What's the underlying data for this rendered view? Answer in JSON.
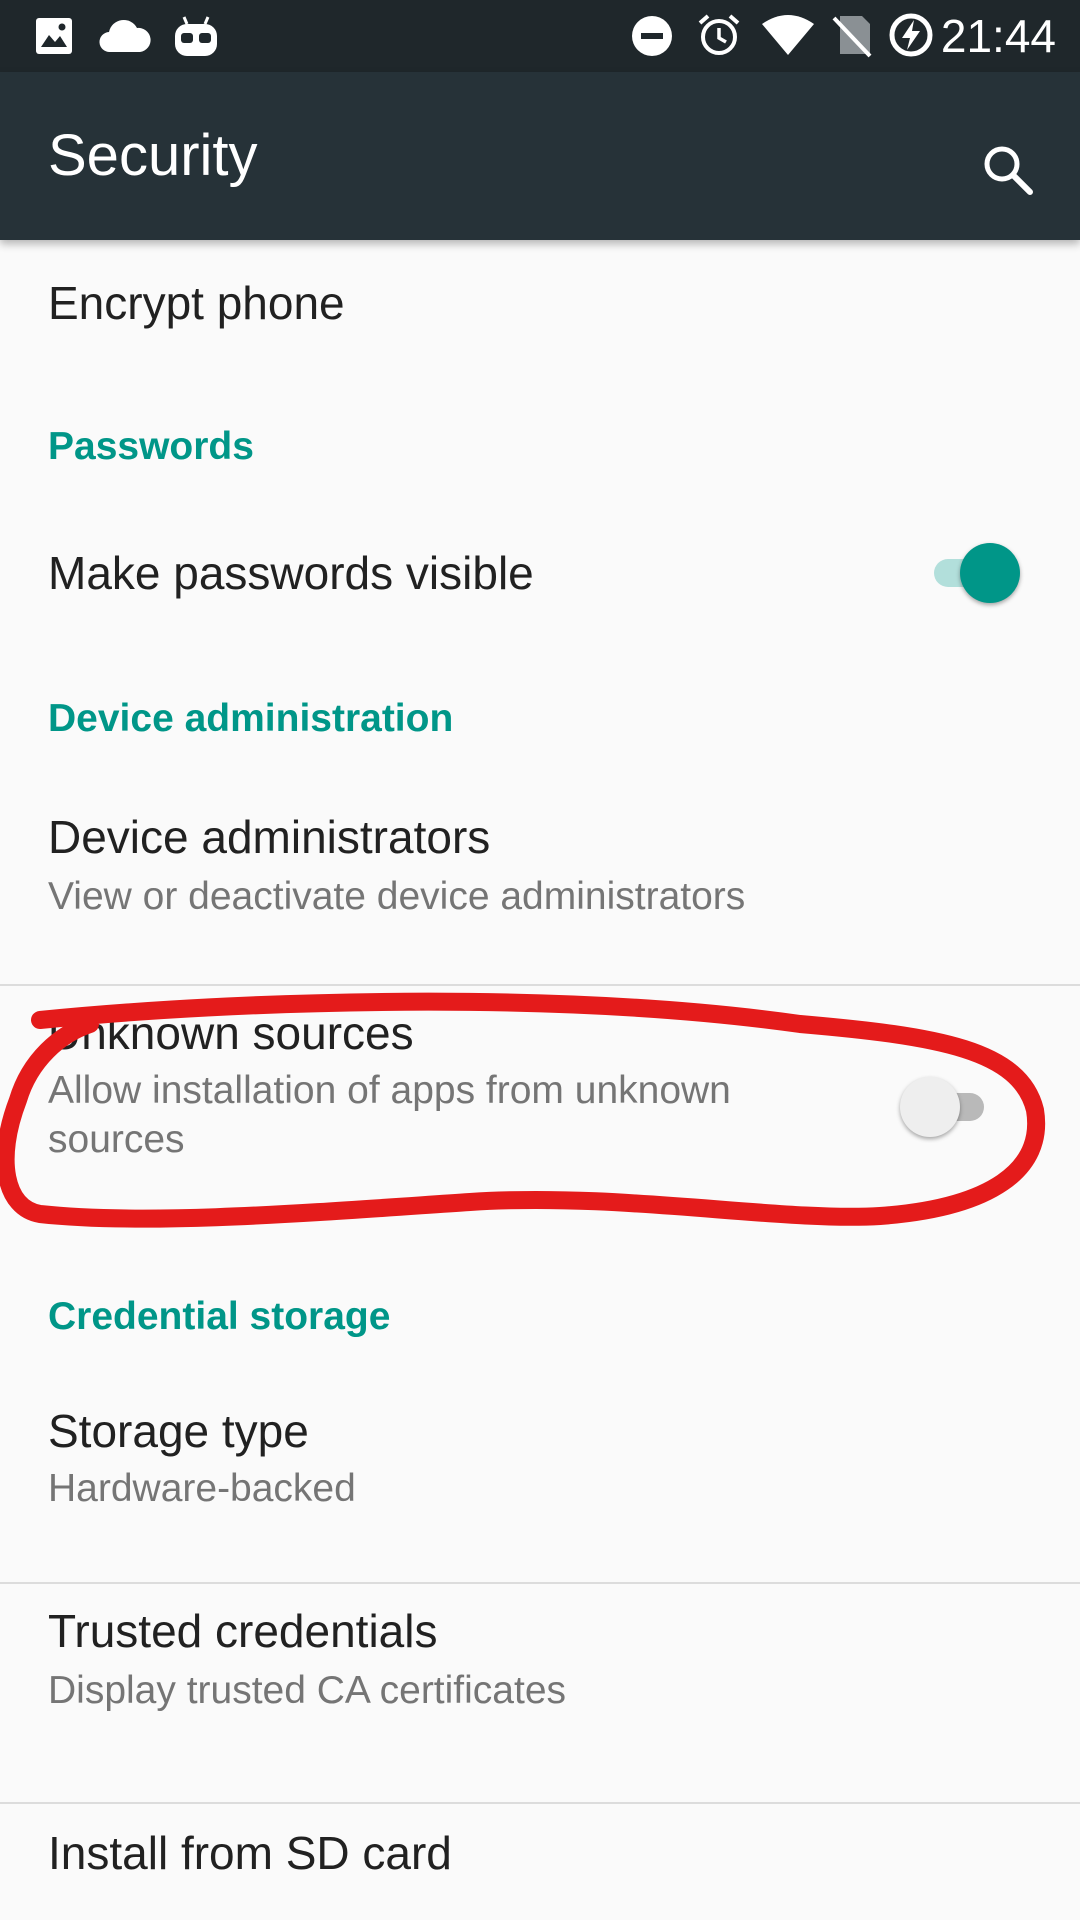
{
  "status_bar": {
    "time": "21:44",
    "icons": [
      "image-icon",
      "cloud-icon",
      "robot-icon",
      "do-not-disturb-icon",
      "alarm-icon",
      "wifi-icon",
      "no-sim-icon",
      "battery-charging-icon"
    ]
  },
  "app_bar": {
    "title": "Security",
    "search_icon": "search-icon"
  },
  "items": {
    "encrypt": {
      "title": "Encrypt phone"
    },
    "passwords_header": "Passwords",
    "make_passwords_visible": {
      "title": "Make passwords visible",
      "checked": true
    },
    "device_admin_header": "Device administration",
    "device_administrators": {
      "title": "Device administrators",
      "summary": "View or deactivate device administrators"
    },
    "unknown_sources": {
      "title": "Unknown sources",
      "summary": "Allow installation of apps from unknown sources",
      "checked": false
    },
    "credential_header": "Credential storage",
    "storage_type": {
      "title": "Storage type",
      "summary": "Hardware-backed"
    },
    "trusted_credentials": {
      "title": "Trusted credentials",
      "summary": "Display trusted CA certificates"
    },
    "install_sd": {
      "title": "Install from SD card"
    }
  },
  "colors": {
    "accent": "#009688",
    "app_bar": "#263238",
    "status_bar": "#1f272b",
    "annotation": "#e41b1b"
  }
}
